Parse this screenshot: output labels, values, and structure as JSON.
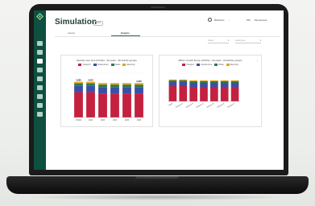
{
  "app": {
    "title": "Simulation",
    "badge": "BETA"
  },
  "header": {
    "org": "World Inc",
    "role": "PM",
    "account": "My Account"
  },
  "tabs": [
    {
      "label": "Assets"
    },
    {
      "label": "Graphs"
    }
  ],
  "active_tab": 1,
  "dropdowns": [
    "Impact",
    "Asset types"
  ],
  "colors": {
    "sidebar": "#0f4f40",
    "accent": "#2f6b58",
    "red": "#c3213f",
    "blue": "#3c4fa6",
    "green": "#2e7a4a",
    "orange": "#e6a21e"
  },
  "sidebar_icons": [
    "home-icon",
    "trend-icon",
    "calculator-icon",
    "bar-chart-icon",
    "database-icon",
    "print-icon",
    "document-icon",
    "share-icon",
    "settings-icon"
  ],
  "chart_data": [
    {
      "type": "bar",
      "stacked": true,
      "title": "Results over time (tCO2e) - All years - All activity groups",
      "categories": [
        "P 2021",
        "2022",
        "2023",
        "2024",
        "2025",
        "2026"
      ],
      "series": [
        {
          "name": "Transport",
          "color": "#c3213f",
          "values": [
            2.0,
            2.0,
            1.9,
            1.9,
            1.9,
            1.9
          ]
        },
        {
          "name": "Infrastructure",
          "color": "#3c4fa6",
          "values": [
            0.5,
            0.5,
            0.5,
            0.5,
            0.5,
            0.5
          ]
        },
        {
          "name": "Waste",
          "color": "#2e7a4a",
          "values": [
            0.2,
            0.2,
            0.2,
            0.2,
            0.2,
            0.2
          ]
        },
        {
          "name": "Electricity",
          "color": "#e6a21e",
          "values": [
            0.12,
            0.12,
            0.12,
            0.12,
            0.12,
            0.12
          ]
        }
      ],
      "totals": [
        "2,885",
        "2,833",
        "",
        "",
        "",
        "2,822"
      ],
      "ylim": [
        0,
        3.5
      ],
      "grid": true,
      "legend_position": "top"
    },
    {
      "type": "bar",
      "stacked": true,
      "title": "Effect of each theme (tCO2e) - All years - All activity groups",
      "categories": [
        "Base",
        "Reduce A",
        "Reduce B",
        "Reduce C",
        "Reduce D",
        "Reduce E",
        "Reduce F"
      ],
      "series": [
        {
          "name": "Transport",
          "color": "#c3213f",
          "values": [
            1.9,
            1.9,
            1.8,
            1.8,
            1.8,
            1.8,
            1.8
          ]
        },
        {
          "name": "Infrastructure",
          "color": "#3c4fa6",
          "values": [
            0.5,
            0.5,
            0.5,
            0.5,
            0.5,
            0.5,
            0.5
          ]
        },
        {
          "name": "Waste",
          "color": "#2e7a4a",
          "values": [
            0.2,
            0.2,
            0.2,
            0.2,
            0.2,
            0.2,
            0.2
          ]
        },
        {
          "name": "Electricity",
          "color": "#e6a21e",
          "values": [
            0.12,
            0.12,
            0.12,
            0.12,
            0.12,
            0.12,
            0.12
          ]
        }
      ],
      "totals": [],
      "ylim": [
        0,
        3.5
      ],
      "grid": true,
      "legend_position": "top"
    }
  ]
}
